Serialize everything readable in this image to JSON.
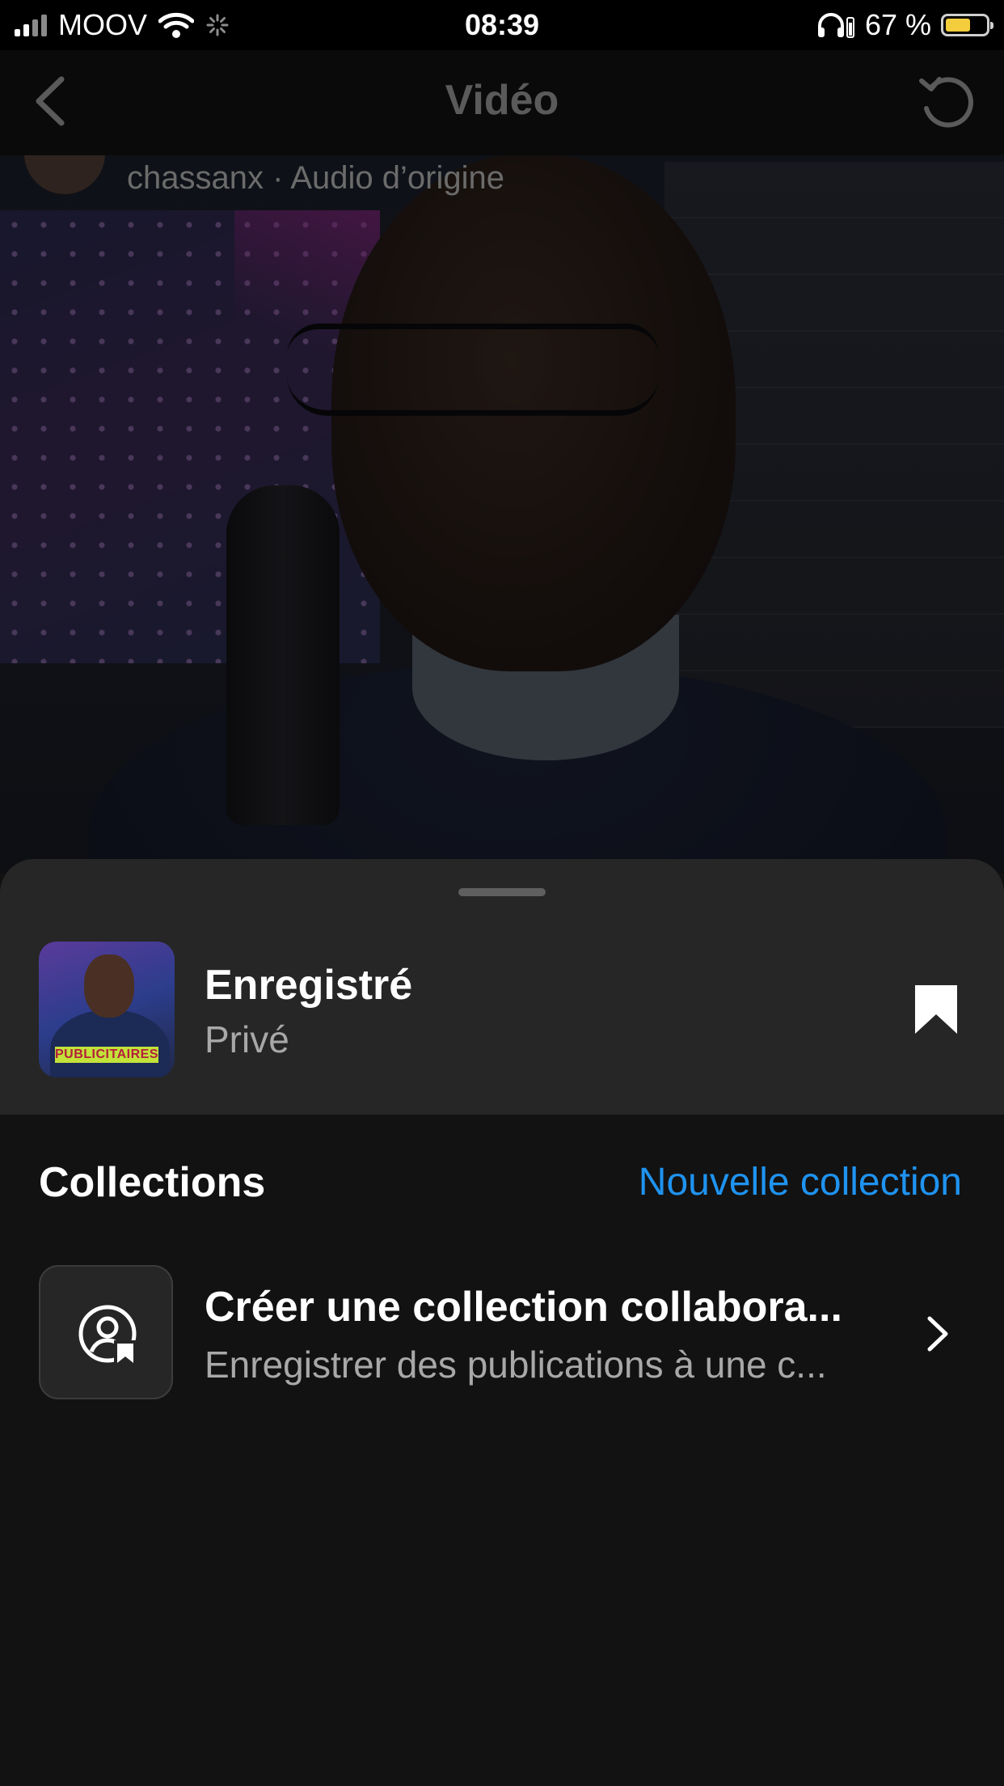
{
  "status_bar": {
    "carrier": "MOOV",
    "time": "08:39",
    "battery_percent": "67 %",
    "battery_level": 0.67,
    "battery_color": "#f4cd3c",
    "icons": [
      "signal-icon",
      "wifi-icon",
      "loading-icon",
      "headphones-battery-icon",
      "battery-icon"
    ]
  },
  "nav": {
    "title": "Vidéo",
    "back_icon": "chevron-left-icon",
    "refresh_icon": "refresh-icon"
  },
  "post": {
    "meta": "chassanx · Audio d’origine"
  },
  "sheet": {
    "saved": {
      "title": "Enregistré",
      "subtitle": "Privé",
      "thumbnail_banner": "PUBLICITAIRES",
      "bookmark_icon": "bookmark-filled-icon"
    },
    "collections_label": "Collections",
    "new_collection_label": "Nouvelle collection",
    "accent_color": "#1f93f0",
    "collab": {
      "title": "Créer une collection collabora...",
      "subtitle": "Enregistrer des publications à une c...",
      "icon": "collaborative-collection-icon",
      "chevron_icon": "chevron-right-icon"
    }
  }
}
